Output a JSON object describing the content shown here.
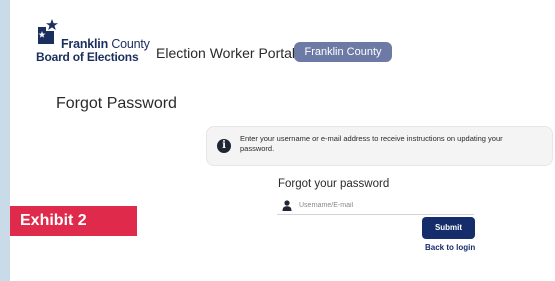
{
  "header": {
    "logo_name_bold": "Franklin",
    "logo_name_light": "County",
    "logo_subtitle": "Board of Elections",
    "portal_title": "Election Worker Portal",
    "county_badge": "Franklin County"
  },
  "page": {
    "heading": "Forgot Password"
  },
  "info": {
    "icon": "info-icon",
    "text": "Enter your username or e-mail address to receive instructions on updating your password."
  },
  "form": {
    "heading": "Forgot your password",
    "username": {
      "icon": "user-icon",
      "placeholder": "Username/E-mail",
      "value": ""
    },
    "submit_label": "Submit",
    "back_link": "Back to login"
  },
  "overlay": {
    "exhibit_label": "Exhibit 2"
  },
  "colors": {
    "brand_navy": "#152d6b",
    "badge": "#6d7aa6",
    "exhibit_red": "#e02a4c",
    "page_background": "#c9dbe9"
  }
}
